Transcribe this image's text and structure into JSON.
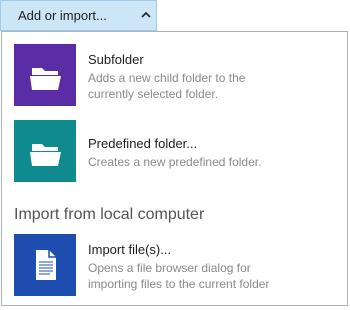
{
  "toolbar": {
    "add_import_label": "Add or import..."
  },
  "menu": {
    "items": [
      {
        "title": "Subfolder",
        "description_lines": [
          "Adds a new child folder to the",
          "currently selected folder."
        ],
        "icon": "folder-icon",
        "tile_color": "#5a2ca6"
      },
      {
        "title": "Predefined folder...",
        "description_lines": [
          "Creates a new predefined folder."
        ],
        "icon": "folder-icon",
        "tile_color": "#0f8a8f"
      }
    ],
    "section_header": "Import from local computer",
    "import_item": {
      "title": "Import file(s)...",
      "description_lines": [
        "Opens a file browser dialog for",
        "importing files to the current folder"
      ],
      "icon": "file-icon",
      "tile_color": "#1d4eb0"
    }
  },
  "colors": {
    "button_bg": "#cde6f7",
    "button_border": "#9ec9e8",
    "description_text": "#8a8a8a"
  }
}
